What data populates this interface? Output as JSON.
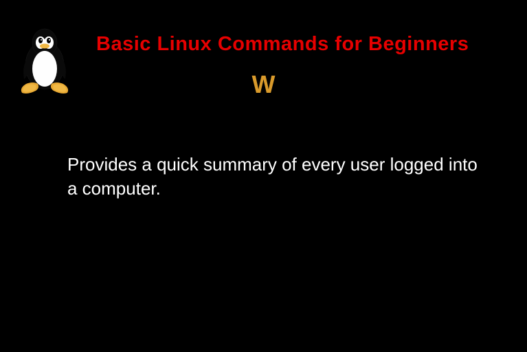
{
  "header": {
    "title": "Basic Linux Commands for Beginners"
  },
  "command": {
    "name": "W",
    "description": "Provides a quick summary of every user logged into a computer."
  },
  "logo": {
    "name": "tux-penguin-icon"
  }
}
